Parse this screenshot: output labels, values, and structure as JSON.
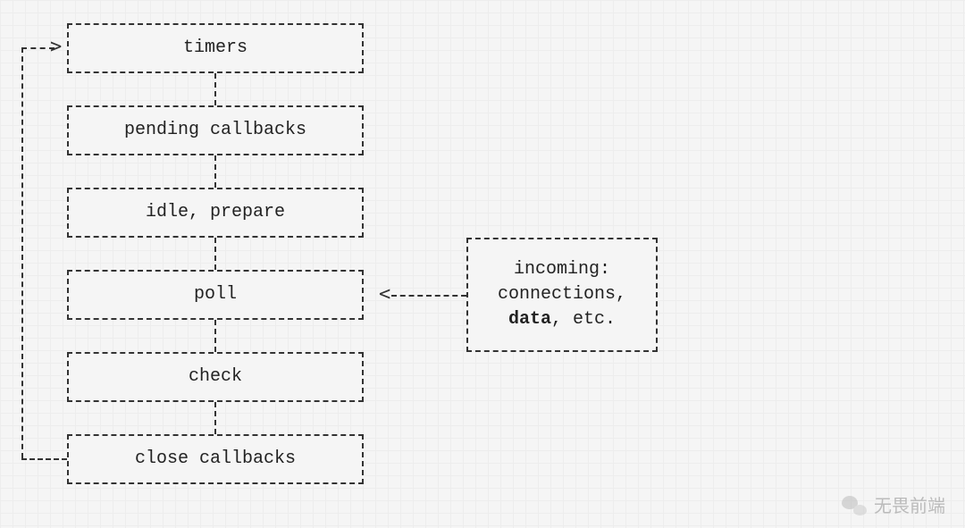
{
  "diagram": {
    "stages": [
      {
        "id": "timers",
        "label": "timers"
      },
      {
        "id": "pending-callbacks",
        "label": "pending callbacks"
      },
      {
        "id": "idle-prepare",
        "label": "idle, prepare"
      },
      {
        "id": "poll",
        "label": "poll"
      },
      {
        "id": "check",
        "label": "check"
      },
      {
        "id": "close-callbacks",
        "label": "close callbacks"
      }
    ],
    "side_box": {
      "line1": "incoming:",
      "line2": "connections,",
      "line3_bold": "data",
      "line3_rest": ", etc."
    },
    "flow": {
      "loop_back_from": "close-callbacks",
      "loop_back_to": "timers",
      "side_input_to": "poll"
    }
  },
  "watermark": {
    "text": "无畏前端",
    "icon": "wechat-icon"
  }
}
